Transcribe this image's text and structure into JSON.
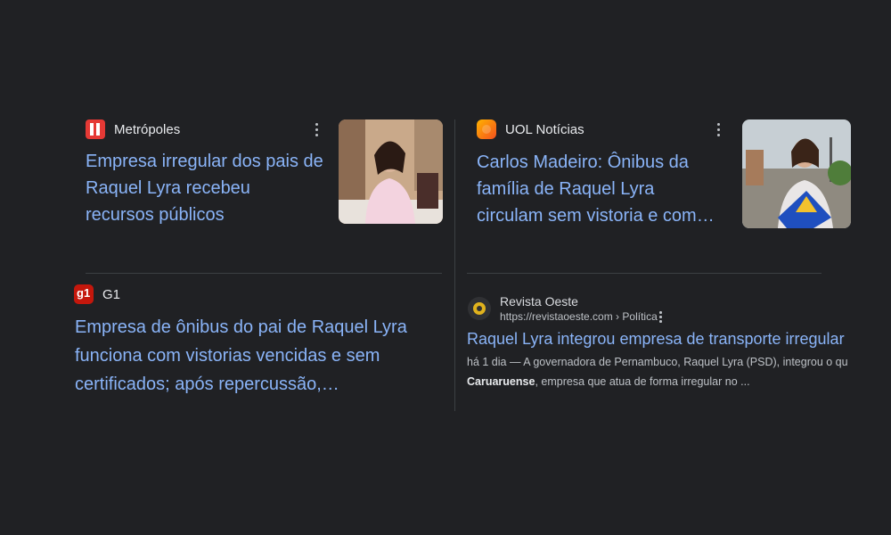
{
  "cards": [
    {
      "source": "Metrópoles",
      "headline_lines": [
        "Empresa irregular dos pais de",
        "Raquel Lyra recebeu",
        "recursos públicos"
      ],
      "favicon_color": "#e53935"
    },
    {
      "source": "UOL Notícias",
      "headline_lines": [
        "Carlos Madeiro: Ônibus da",
        "família de Raquel Lyra",
        "circulam sem vistoria e com…"
      ],
      "favicon_color": "#f57c00"
    },
    {
      "source": "G1",
      "favicon_text": "g1",
      "headline_lines": [
        "Empresa de ônibus do pai de Raquel Lyra",
        "funciona com vistorias vencidas e sem",
        "certificados; após repercussão,…"
      ],
      "favicon_color": "#c4170c"
    }
  ],
  "result": {
    "source": "Revista Oeste",
    "url": "https://revistaoeste.com › Política",
    "title": "Raquel Lyra integrou empresa de transporte irregular",
    "snippet_line1": "há 1 dia — A governadora de Pernambuco, Raquel Lyra (PSD), integrou o qu",
    "snippet_bold": "Caruaruense",
    "snippet_line2_rest": ", empresa que atua de forma irregular no ..."
  },
  "colors": {
    "background": "#202124",
    "link": "#8ab4f8",
    "text": "#e8eaed",
    "muted": "#bdc1c6"
  },
  "icons": [
    "more-vert-icon"
  ]
}
